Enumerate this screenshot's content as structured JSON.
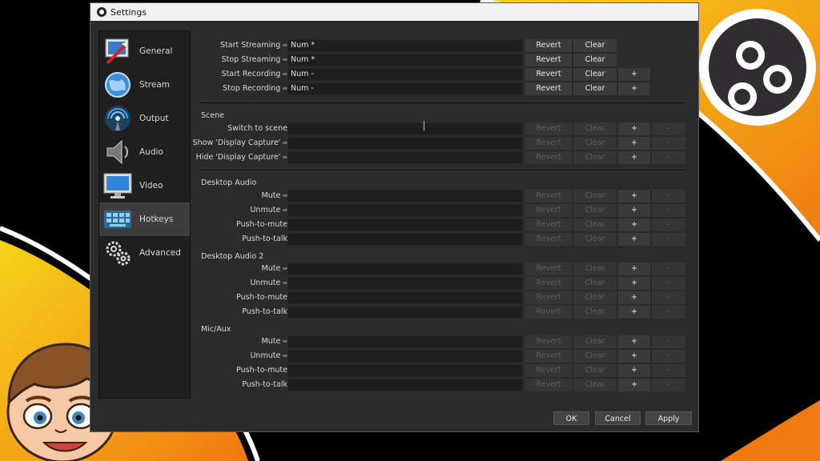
{
  "window": {
    "title": "Settings"
  },
  "sidebar": {
    "items": [
      {
        "label": "General"
      },
      {
        "label": "Stream"
      },
      {
        "label": "Output"
      },
      {
        "label": "Audio"
      },
      {
        "label": "Video"
      },
      {
        "label": "Hotkeys"
      },
      {
        "label": "Advanced"
      }
    ]
  },
  "buttons": {
    "revert": "Revert",
    "clear": "Clear",
    "add": "+",
    "remove": "-"
  },
  "top_rows": [
    {
      "label": "Start Streaming",
      "value": "Num *"
    },
    {
      "label": "Stop Streaming",
      "value": "Num *"
    },
    {
      "label": "Start Recording",
      "value": "Num -"
    },
    {
      "label": "Stop Recording",
      "value": "Num -"
    }
  ],
  "sections": {
    "scene": {
      "title": "Scene",
      "rows": [
        {
          "label": "Switch to scene",
          "value": ""
        },
        {
          "label": "Show 'Display Capture'",
          "value": ""
        },
        {
          "label": "Hide 'Display Capture'",
          "value": ""
        }
      ]
    },
    "desktop_audio": {
      "title": "Desktop Audio",
      "rows": [
        {
          "label": "Mute",
          "value": ""
        },
        {
          "label": "Unmute",
          "value": ""
        },
        {
          "label": "Push-to-mute",
          "value": ""
        },
        {
          "label": "Push-to-talk",
          "value": ""
        }
      ]
    },
    "desktop_audio_2": {
      "title": "Desktop Audio 2",
      "rows": [
        {
          "label": "Mute",
          "value": ""
        },
        {
          "label": "Unmute",
          "value": ""
        },
        {
          "label": "Push-to-mute",
          "value": ""
        },
        {
          "label": "Push-to-talk",
          "value": ""
        }
      ]
    },
    "mic_aux": {
      "title": "Mic/Aux",
      "rows": [
        {
          "label": "Mute",
          "value": ""
        },
        {
          "label": "Unmute",
          "value": ""
        },
        {
          "label": "Push-to-mute",
          "value": ""
        },
        {
          "label": "Push-to-talk",
          "value": ""
        }
      ]
    }
  },
  "footer": {
    "ok": "OK",
    "cancel": "Cancel",
    "apply": "Apply"
  },
  "colors": {
    "accent_orange": "#f39a12",
    "accent_yellow": "#f7d51a",
    "window_bg": "#2b2b2b"
  }
}
